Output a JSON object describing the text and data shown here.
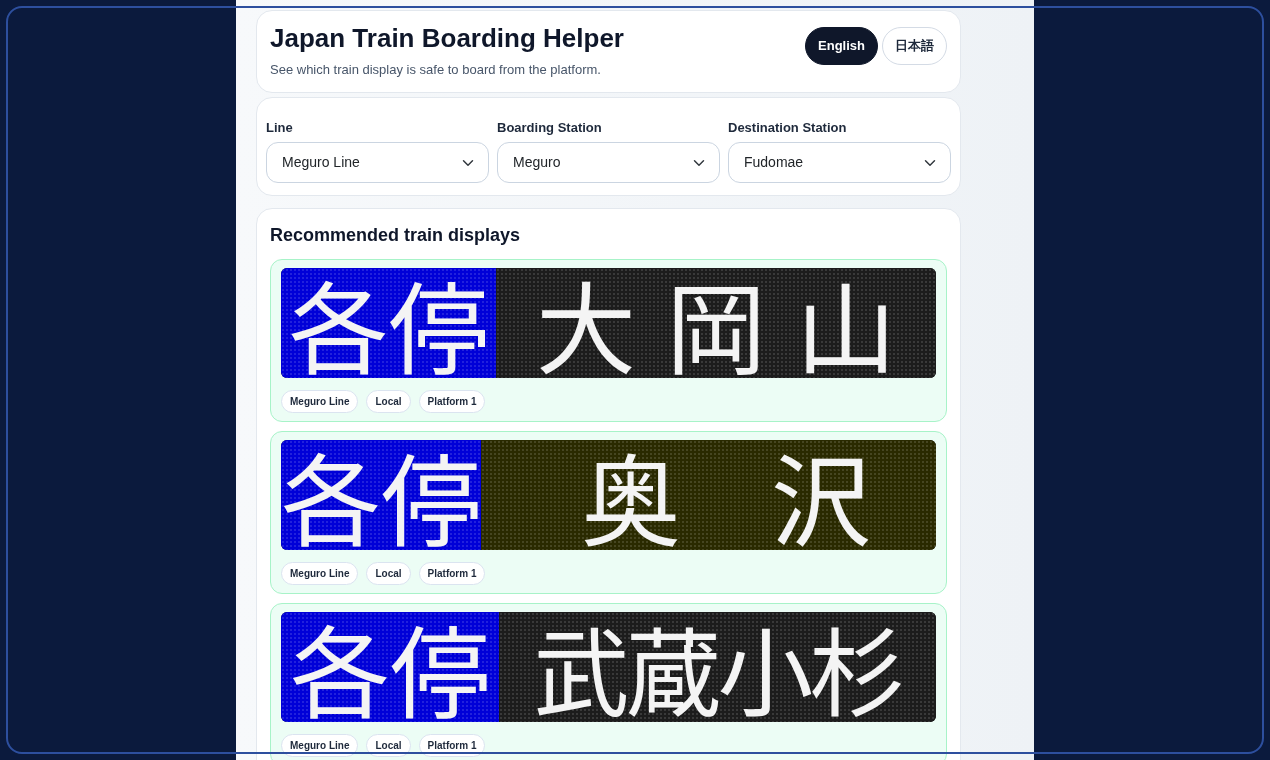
{
  "header": {
    "title": "Japan Train Boarding Helper",
    "subtitle": "See which train display is safe to board from the platform.",
    "languages": [
      {
        "label": "English",
        "selected": true
      },
      {
        "label": "日本語",
        "selected": false
      }
    ]
  },
  "selectors": [
    {
      "label": "Line",
      "value": "Meguro Line"
    },
    {
      "label": "Boarding Station",
      "value": "Meguro"
    },
    {
      "label": "Destination Station",
      "value": "Fudomae"
    }
  ],
  "recommendations": {
    "title": "Recommended train displays",
    "displays": [
      {
        "type": "各停",
        "destination": "大岡山",
        "color": "#1c1c1c",
        "tags": [
          "Meguro Line",
          "Local",
          "Platform 1"
        ]
      },
      {
        "type": "各停",
        "destination": "奥沢",
        "color": "#2a2a00",
        "tags": [
          "Meguro Line",
          "Local",
          "Platform 1"
        ]
      },
      {
        "type": "各停",
        "destination": "武蔵小杉",
        "color": "#1c1c1c",
        "tags": [
          "Meguro Line",
          "Local",
          "Platform 1"
        ]
      }
    ]
  }
}
